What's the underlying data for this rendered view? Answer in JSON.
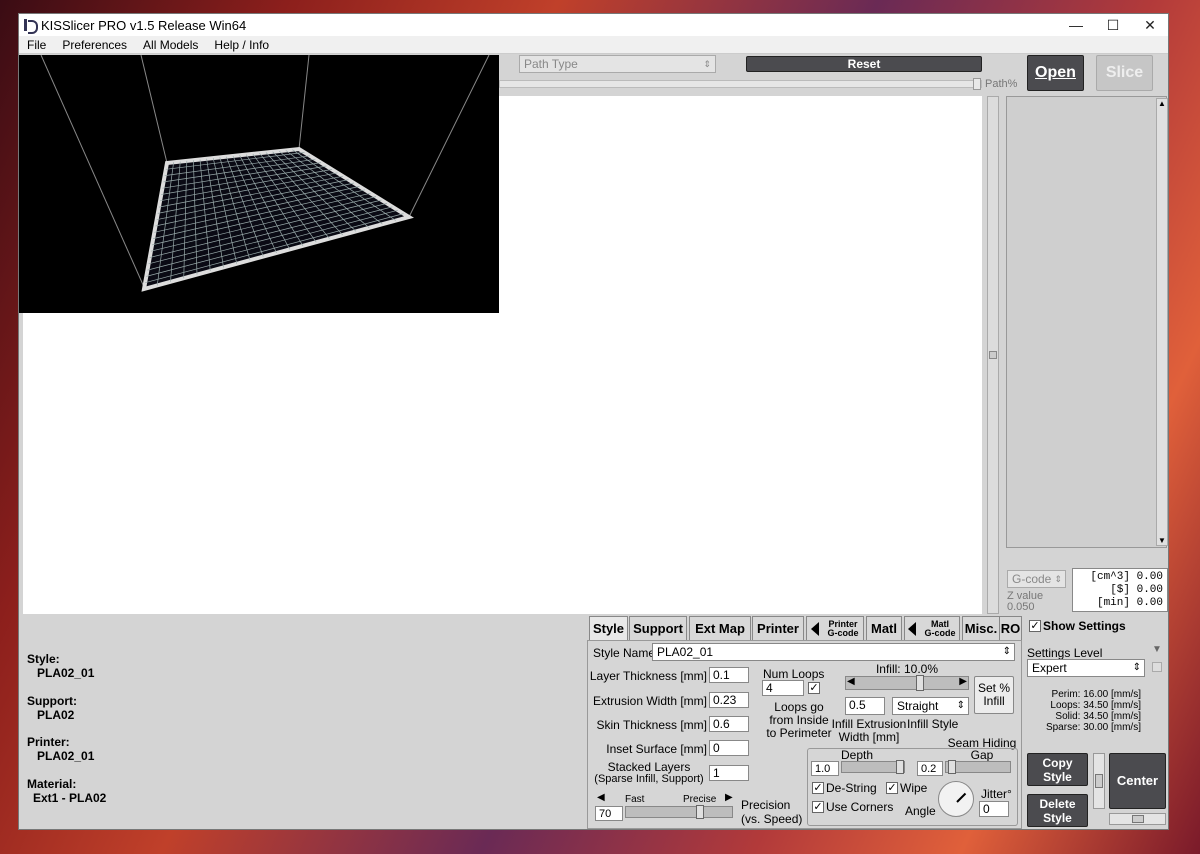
{
  "window": {
    "title": "KISSlicer PRO v1.5 Release Win64",
    "controls": {
      "minimize": "—",
      "maximize": "☐",
      "close": "✕"
    }
  },
  "menu": [
    "File",
    "Preferences",
    "All Models",
    "Help / Info"
  ],
  "toolbar": {
    "path_type": "Path Type",
    "reset": "Reset",
    "open": "Open",
    "slice": "Slice",
    "path_pct": "Path%"
  },
  "stats": {
    "gcode_combo": "G-code",
    "z_value_label": "Z value",
    "z_value": "0.050",
    "cm3": "[cm^3] 0.00",
    "dollars": "[$] 0.00",
    "min": "[min] 0.00"
  },
  "summary": {
    "style_label": "Style:",
    "style_value": "PLA02_01",
    "support_label": "Support:",
    "support_value": "PLA02",
    "printer_label": "Printer:",
    "printer_value": "PLA02_01",
    "material_label": "Material:",
    "material_value": "Ext1 -  PLA02"
  },
  "tabs": {
    "style": "Style",
    "support": "Support",
    "ext_map": "Ext Map",
    "printer": "Printer",
    "printer_gcode_1": "Printer",
    "printer_gcode_2": "G-code",
    "matl": "Matl",
    "matl_gcode_1": "Matl",
    "matl_gcode_2": "G-code",
    "misc": "Misc.",
    "pro": "RO"
  },
  "style_panel": {
    "style_name_label": "Style Name",
    "style_name_value": "PLA02_01",
    "layer_thickness_label": "Layer Thickness [mm]",
    "layer_thickness": "0.1",
    "extrusion_width_label": "Extrusion Width [mm]",
    "extrusion_width": "0.23",
    "skin_thickness_label": "Skin Thickness [mm]",
    "skin_thickness": "0.6",
    "inset_surface_label": "Inset  Surface [mm]",
    "inset_surface": "0",
    "stacked_layers_label_1": "Stacked Layers",
    "stacked_layers_label_2": "(Sparse Infill, Support)",
    "stacked_layers": "1",
    "num_loops_label": "Num Loops",
    "num_loops": "4",
    "loops_go_1": "Loops go",
    "loops_go_2": "from Inside",
    "loops_go_3": "to Perimeter",
    "infill_label": "Infill: 10.0%",
    "infill_pct": 10,
    "infill_ext_width": "0.5",
    "infill_ext_label_1": "Infill Extrusion",
    "infill_ext_label_2": "Width [mm]",
    "infill_style": "Straight",
    "infill_style_label": "Infill Style",
    "set_pct_1": "Set %",
    "set_pct_2": "Infill",
    "seam_label_1": "Seam Hiding",
    "seam_label_2": "Gap",
    "depth_label": "Depth",
    "depth_value": "1.0",
    "gap_value": "0.2",
    "destring": "De-String",
    "wipe": "Wipe",
    "use_corners": "Use Corners",
    "angle_label": "Angle",
    "jitter_label": "Jitter°",
    "jitter_value": "0",
    "fast_label": "Fast",
    "precise_label": "Precise",
    "precision_value": "70",
    "precision_label_1": "Precision",
    "precision_label_2": "(vs. Speed)"
  },
  "settings": {
    "show_settings": "Show Settings",
    "level_label": "Settings Level",
    "level_value": "Expert",
    "perim": "Perim:  16.00 [mm/s]",
    "loops": "Loops:  34.50 [mm/s]",
    "solid": "Solid:  34.50 [mm/s]",
    "sparse": "Sparse: 30.00 [mm/s]",
    "copy_style_1": "Copy",
    "copy_style_2": "Style",
    "delete_style_1": "Delete",
    "delete_style_2": "Style",
    "center": "Center"
  },
  "colors": {
    "dark_button": "#4b4b4f",
    "panel_bg": "#d2d2d2",
    "viewport_bg": "#000000"
  }
}
